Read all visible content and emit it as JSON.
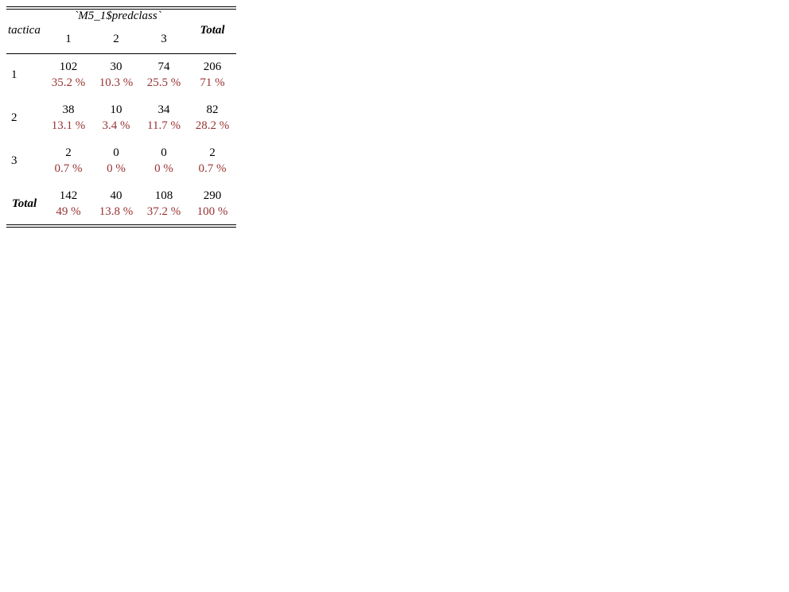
{
  "table": {
    "row_var": "tactica",
    "col_var": "`M5_1$predclass`",
    "columns": [
      "1",
      "2",
      "3"
    ],
    "total_label": "Total",
    "rows": [
      {
        "label": "1",
        "cells": [
          {
            "count": "102",
            "pct": "35.2 %"
          },
          {
            "count": "30",
            "pct": "10.3 %"
          },
          {
            "count": "74",
            "pct": "25.5 %"
          },
          {
            "count": "206",
            "pct": "71 %"
          }
        ]
      },
      {
        "label": "2",
        "cells": [
          {
            "count": "38",
            "pct": "13.1 %"
          },
          {
            "count": "10",
            "pct": "3.4 %"
          },
          {
            "count": "34",
            "pct": "11.7 %"
          },
          {
            "count": "82",
            "pct": "28.2 %"
          }
        ]
      },
      {
        "label": "3",
        "cells": [
          {
            "count": "2",
            "pct": "0.7 %"
          },
          {
            "count": "0",
            "pct": "0 %"
          },
          {
            "count": "0",
            "pct": "0 %"
          },
          {
            "count": "2",
            "pct": "0.7 %"
          }
        ]
      },
      {
        "label": "Total",
        "cells": [
          {
            "count": "142",
            "pct": "49 %"
          },
          {
            "count": "40",
            "pct": "13.8 %"
          },
          {
            "count": "108",
            "pct": "37.2 %"
          },
          {
            "count": "290",
            "pct": "100 %"
          }
        ]
      }
    ]
  },
  "colors": {
    "text": "#000000",
    "percent": "#993333",
    "background": "#ffffff"
  }
}
